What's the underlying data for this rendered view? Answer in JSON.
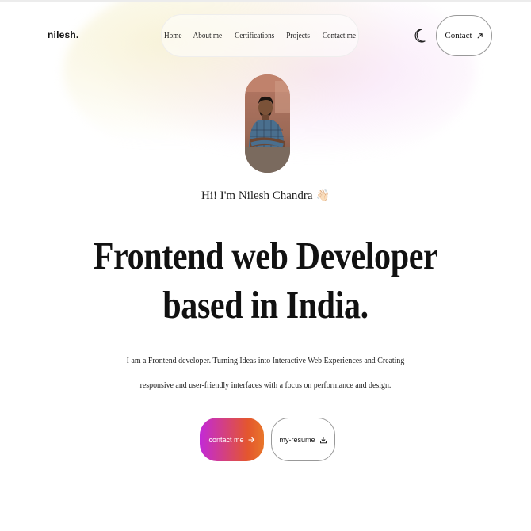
{
  "header": {
    "logo": "nilesh.",
    "nav": [
      "Home",
      "About me",
      "Certifications",
      "Projects",
      "Contact me"
    ],
    "theme_icon": "moon-icon",
    "contact_label": "Contact",
    "contact_icon": "arrow-up-right-icon"
  },
  "hero": {
    "avatar_icon": "profile-photo",
    "greeting": "Hi! I'm Nilesh Chandra",
    "greeting_emoji": "👋🏻",
    "headline_line1": "Frontend web Developer",
    "headline_line2": "based in India.",
    "description_line1": "I am a Frontend developer. Turning Ideas into Interactive Web Experiences and Creating",
    "description_line2": "responsive and user-friendly interfaces with a focus on performance and design.",
    "primary_button": "contact me",
    "primary_icon": "arrow-right-icon",
    "secondary_button": "my-resume",
    "secondary_icon": "download-icon"
  },
  "colors": {
    "gradient_start": "#c229d8",
    "gradient_end": "#e8762a",
    "text": "#111111",
    "background": "#ffffff"
  }
}
